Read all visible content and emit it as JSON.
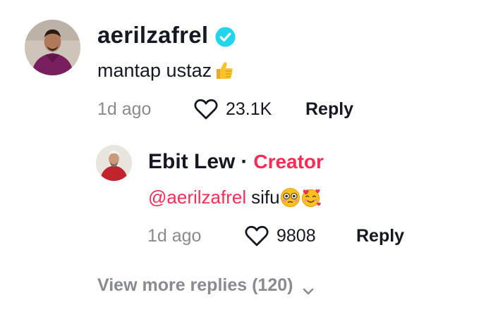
{
  "comment": {
    "username": "aerilzafrel",
    "verified": true,
    "text": "mantap ustaz",
    "text_emoji": "thumbs-up",
    "timestamp": "1d ago",
    "likes": "23.1K",
    "reply_label": "Reply"
  },
  "reply": {
    "username": "Ebit Lew",
    "separator": "·",
    "role_badge": "Creator",
    "mention": "@aerilzafrel",
    "text": "sifu",
    "text_emojis": [
      "flushed-face",
      "smiling-face-with-hearts"
    ],
    "timestamp": "1d ago",
    "likes": "9808",
    "reply_label": "Reply"
  },
  "view_more": {
    "label": "View more replies (120)"
  },
  "colors": {
    "accent": "#fe2c55",
    "verified": "#20d5ec",
    "muted": "#8a8b91",
    "text": "#161823"
  }
}
